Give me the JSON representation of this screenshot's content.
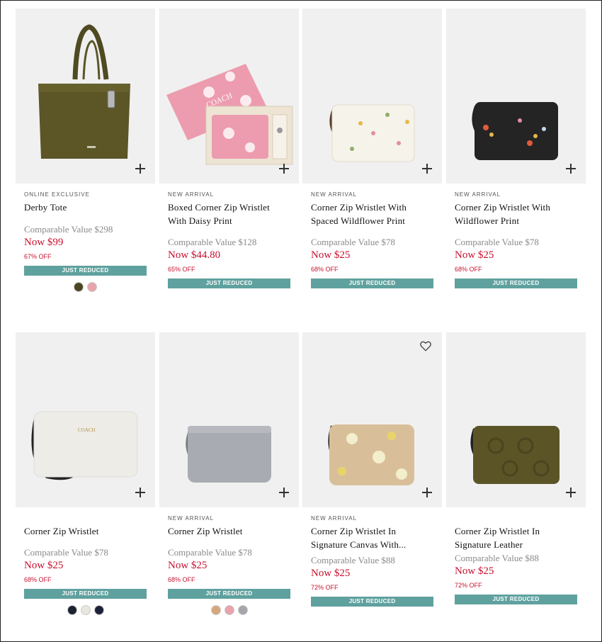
{
  "products": [
    {
      "badge": "ONLINE EXCLUSIVE",
      "name": "Derby Tote",
      "comparable": "Comparable Value $298",
      "now": "Now $99",
      "off": "67% OFF",
      "reduced": "JUST REDUCED",
      "swatches": [
        "#4a4622",
        "#e8a3ab"
      ]
    },
    {
      "badge": "NEW ARRIVAL",
      "name": "Boxed Corner Zip Wristlet With Daisy Print",
      "comparable": "Comparable Value $128",
      "now": "Now $44.80",
      "off": "65% OFF",
      "reduced": "JUST REDUCED"
    },
    {
      "badge": "NEW ARRIVAL",
      "name": "Corner Zip Wristlet With Spaced Wildflower Print",
      "comparable": "Comparable Value $78",
      "now": "Now $25",
      "off": "68% OFF",
      "reduced": "JUST REDUCED"
    },
    {
      "badge": "NEW ARRIVAL",
      "name": "Corner Zip Wristlet With Wildflower Print",
      "comparable": "Comparable Value $78",
      "now": "Now $25",
      "off": "68% OFF",
      "reduced": "JUST REDUCED"
    },
    {
      "badge": "",
      "name": "Corner Zip Wristlet",
      "comparable": "Comparable Value $78",
      "now": "Now $25",
      "off": "68% OFF",
      "reduced": "JUST REDUCED",
      "swatches": [
        "#1c2230",
        "#e9e6de",
        "#1d2238"
      ]
    },
    {
      "badge": "NEW ARRIVAL",
      "name": "Corner Zip Wristlet",
      "comparable": "Comparable Value $78",
      "now": "Now $25",
      "off": "68% OFF",
      "reduced": "JUST REDUCED",
      "swatches": [
        "#d6a77f",
        "#e8a3ab",
        "#a4a6ac"
      ]
    },
    {
      "badge": "NEW ARRIVAL",
      "name": "Corner Zip Wristlet In Signature Canvas With...",
      "comparable": "Comparable Value $88",
      "now": "Now $25",
      "off": "72% OFF",
      "reduced": "JUST REDUCED"
    },
    {
      "badge": "",
      "name": "Corner Zip Wristlet In Signature Leather",
      "comparable": "Comparable Value $88",
      "now": "Now $25",
      "off": "72% OFF",
      "reduced": "JUST REDUCED"
    }
  ]
}
